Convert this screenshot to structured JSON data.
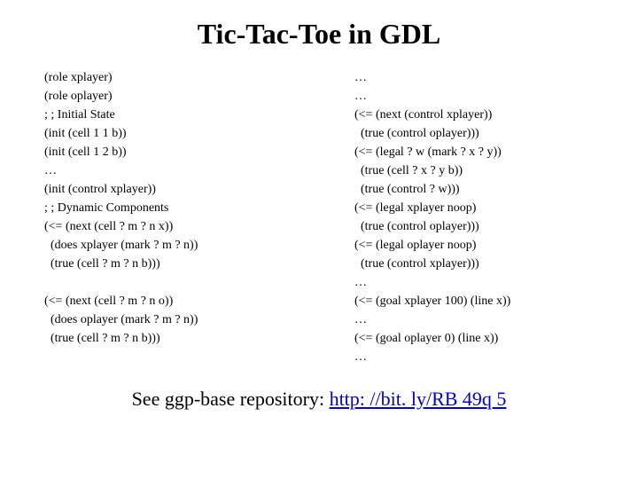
{
  "title": "Tic-Tac-Toe in GDL",
  "left": {
    "l0": "(role xplayer)",
    "l1": "(role oplayer)",
    "l2": "; ; Initial State",
    "l3": "(init (cell 1 1 b))",
    "l4": "(init (cell 1 2 b))",
    "l5": "…",
    "l6": "(init (control xplayer))",
    "l7": "; ; Dynamic Components",
    "l8": "(<= (next (cell ? m ? n x))",
    "l9": "  (does xplayer (mark ? m ? n))",
    "l10": "  (true (cell ? m ? n b)))",
    "l11": " ",
    "l12": "(<= (next (cell ? m ? n o))",
    "l13": "  (does oplayer (mark ? m ? n))",
    "l14": "  (true (cell ? m ? n b)))"
  },
  "right": {
    "r0": "…",
    "r1": "…",
    "r2": "(<= (next (control xplayer))",
    "r3": "  (true (control oplayer)))",
    "r4": "(<= (legal ? w (mark ? x ? y))",
    "r5": "  (true (cell ? x ? y b))",
    "r6": "  (true (control ? w)))",
    "r7": "(<= (legal xplayer noop)",
    "r8": "  (true (control oplayer)))",
    "r9": "(<= (legal oplayer noop)",
    "r10": "  (true (control xplayer)))",
    "r11": "…",
    "r12": "(<= (goal xplayer 100) (line x))",
    "r13": "…",
    "r14": "(<= (goal oplayer 0) (line x))",
    "r15": "…"
  },
  "footer": {
    "prefix": "See ggp-base repository: ",
    "link_text": "http: //bit. ly/RB 49q 5"
  }
}
